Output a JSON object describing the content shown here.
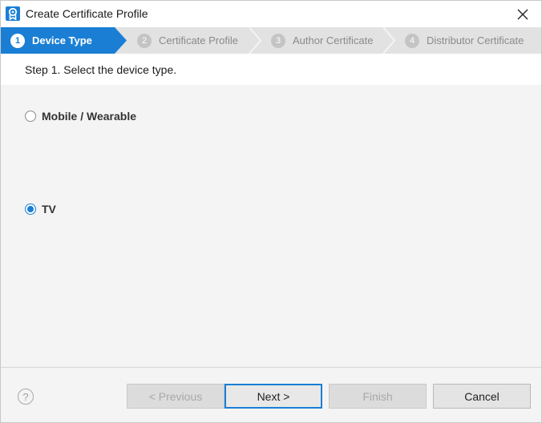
{
  "window": {
    "title": "Create Certificate Profile"
  },
  "stepper": {
    "steps": [
      {
        "number": "1",
        "label": "Device Type",
        "state": "active"
      },
      {
        "number": "2",
        "label": "Certificate Profile",
        "state": "inactive"
      },
      {
        "number": "3",
        "label": "Author Certificate",
        "state": "inactive"
      },
      {
        "number": "4",
        "label": "Distributor Certificate",
        "state": "inactive"
      }
    ]
  },
  "instruction": "Step 1. Select the device type.",
  "device_types": [
    {
      "label": "Mobile / Wearable",
      "checked": false
    },
    {
      "label": "TV",
      "checked": true
    }
  ],
  "footer": {
    "help_label": "?",
    "previous_label": "< Previous",
    "next_label": "Next >",
    "finish_label": "Finish",
    "cancel_label": "Cancel"
  },
  "colors": {
    "accent": "#1a7fd4",
    "stepper_inactive_bg": "#e2e2e2"
  }
}
